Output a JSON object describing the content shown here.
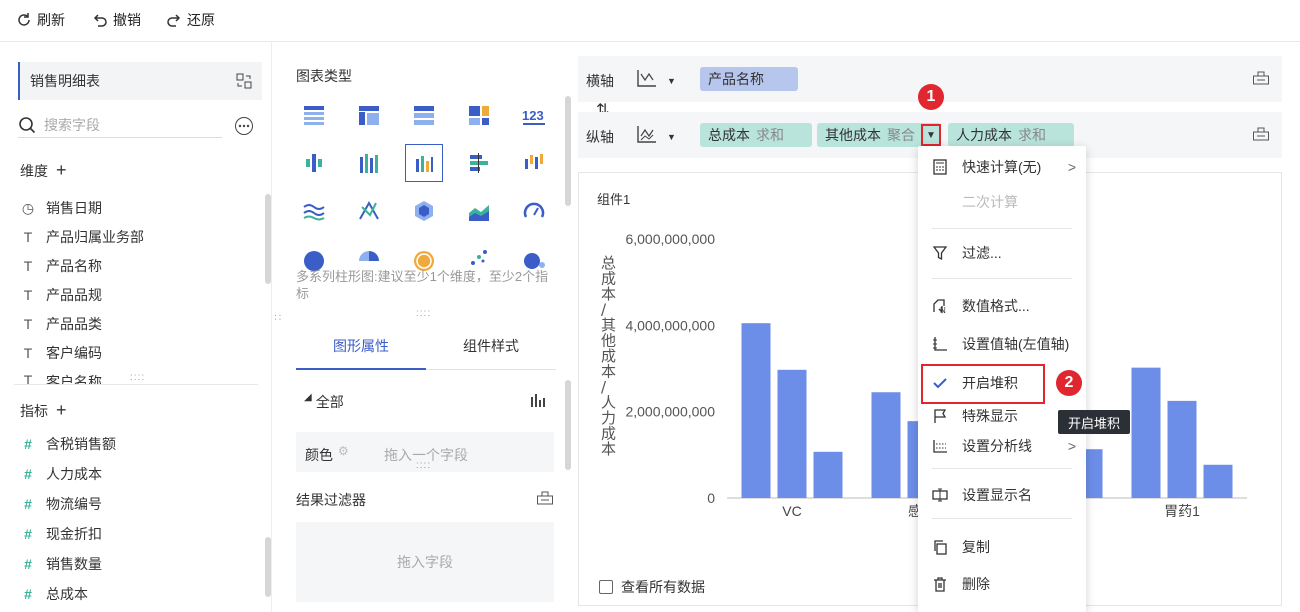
{
  "toolbar": {
    "refresh": "刷新",
    "undo": "撤销",
    "redo": "还原"
  },
  "left": {
    "dataset": "销售明细表",
    "search_placeholder": "搜索字段",
    "dimensions_title": "维度",
    "dimensions": [
      {
        "icon": "clock-icon",
        "label": "销售日期"
      },
      {
        "icon": "text-type-icon",
        "label": "产品归属业务部"
      },
      {
        "icon": "text-type-icon",
        "label": "产品名称"
      },
      {
        "icon": "text-type-icon",
        "label": "产品品规"
      },
      {
        "icon": "text-type-icon",
        "label": "产品品类"
      },
      {
        "icon": "text-type-icon",
        "label": "客户编码"
      },
      {
        "icon": "text-type-icon",
        "label": "客户名称"
      }
    ],
    "measures_title": "指标",
    "measures": [
      "含税销售额",
      "人力成本",
      "物流编号",
      "现金折扣",
      "销售数量",
      "总成本"
    ]
  },
  "mid": {
    "chart_types_title": "图表类型",
    "hint": "多系列柱形图:建议至少1个维度，至少2个指标",
    "tab_props": "图形属性",
    "tab_style": "组件样式",
    "all_label": "全部",
    "color_label": "颜色",
    "drag_one": "拖入一个字段",
    "filter_title": "结果过滤器",
    "drag_field": "拖入字段",
    "num_icon": "123"
  },
  "axes": {
    "x_label": "横轴",
    "y_label": "纵轴",
    "swap": "⇅",
    "x_fields": [
      {
        "name": "产品名称"
      }
    ],
    "y_fields": [
      {
        "name": "总成本",
        "agg": "求和"
      },
      {
        "name": "其他成本",
        "agg": "聚合"
      },
      {
        "name": "人力成本",
        "agg": "求和"
      }
    ]
  },
  "chart": {
    "component_title": "组件1",
    "view_all": "查看所有数据",
    "y_axis_title": "总成本/其他成本/人力成本"
  },
  "chart_data": {
    "type": "bar",
    "ylabel": "总成本/其他成本/人力成本",
    "ylim": [
      0,
      6000000000
    ],
    "yticks": [
      "6,000,000,000",
      "4,000,000,000",
      "2,000,000,000",
      "0"
    ],
    "categories": [
      "VC",
      "感冒",
      "",
      "胃药1"
    ],
    "series": [
      {
        "values": [
          4050000000,
          2450000000,
          0,
          3020000000
        ]
      },
      {
        "values": [
          2970000000,
          1780000000,
          1130000000,
          2250000000
        ]
      },
      {
        "values": [
          1070000000,
          0,
          1130000000,
          770000000
        ]
      }
    ],
    "color": "#6c8ee8"
  },
  "menu": {
    "items": [
      {
        "icon": "calculator-icon",
        "label": "快速计算(无)",
        "arrow": true
      },
      {
        "icon": "",
        "label": "二次计算",
        "disabled": true
      },
      {
        "icon": "filter-icon",
        "label": "过滤..."
      },
      {
        "icon": "number-format-icon",
        "label": "数值格式..."
      },
      {
        "icon": "axis-icon",
        "label": "设置值轴(左值轴)"
      },
      {
        "icon": "check-icon",
        "label": "开启堆积"
      },
      {
        "icon": "flag-icon",
        "label": "特殊显示"
      },
      {
        "icon": "analysis-line-icon",
        "label": "设置分析线",
        "arrow": true
      },
      {
        "icon": "rename-icon",
        "label": "设置显示名"
      },
      {
        "icon": "copy-icon",
        "label": "复制"
      },
      {
        "icon": "trash-icon",
        "label": "删除"
      }
    ],
    "tooltip": "开启堆积",
    "badge1": "1",
    "badge2": "2",
    "arrow_glyph": ">"
  },
  "colors": {
    "accent": "#3a5dc8",
    "bar": "#6c8ee8",
    "pill_blue": "#b7c6ec",
    "pill_teal": "#b8e4dc",
    "badge": "#e0262e"
  }
}
